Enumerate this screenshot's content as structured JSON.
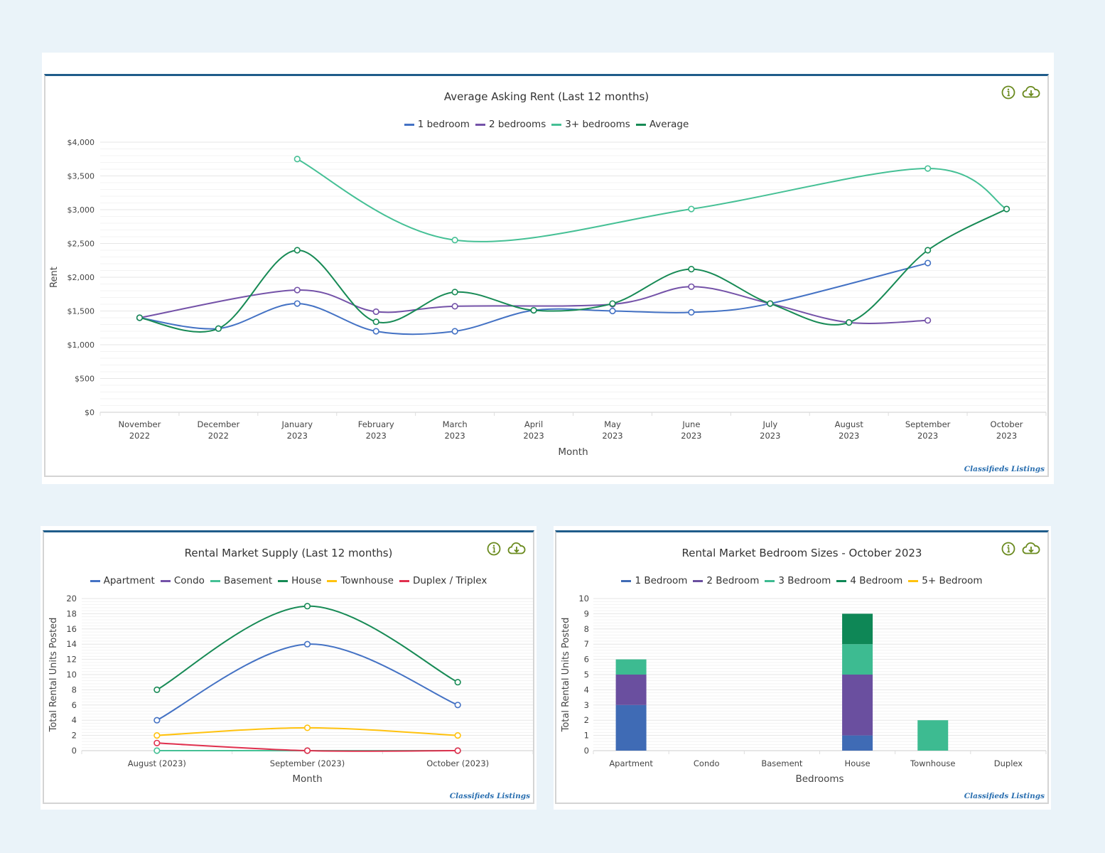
{
  "colors": {
    "panel_top": "#1f5c8a",
    "icon": "#6a8a1e",
    "credit": "#2a6fb0"
  },
  "icons": [
    "info-icon",
    "cloud-download-icon"
  ],
  "credit": "Classifieds Listings",
  "chart_data": [
    {
      "type": "line",
      "title": "Average Asking Rent (Last 12 months)",
      "xlabel": "Month",
      "ylabel": "Rent",
      "ylim": [
        0,
        4000
      ],
      "grid": true,
      "legend": "top",
      "y_ticks": [
        0,
        500,
        1000,
        1500,
        2000,
        2500,
        3000,
        3500,
        4000
      ],
      "y_tick_labels": [
        "$0",
        "$500",
        "$1,000",
        "$1,500",
        "$2,000",
        "$2,500",
        "$3,000",
        "$3,500",
        "$4,000"
      ],
      "categories": [
        [
          "November",
          "2022"
        ],
        [
          "December",
          "2022"
        ],
        [
          "January",
          "2023"
        ],
        [
          "February",
          "2023"
        ],
        [
          "March",
          "2023"
        ],
        [
          "April",
          "2023"
        ],
        [
          "May",
          "2023"
        ],
        [
          "June",
          "2023"
        ],
        [
          "July",
          "2023"
        ],
        [
          "August",
          "2023"
        ],
        [
          "September",
          "2023"
        ],
        [
          "October",
          "2023"
        ]
      ],
      "series": [
        {
          "name": "1 bedroom",
          "color": "#4472c4",
          "values": [
            1400,
            1240,
            1610,
            1200,
            1200,
            1510,
            1500,
            1480,
            1610,
            null,
            2210,
            null
          ]
        },
        {
          "name": "2 bedrooms",
          "color": "#7452a8",
          "values": [
            1400,
            null,
            1810,
            1490,
            1570,
            null,
            1600,
            1860,
            1610,
            1330,
            1360,
            null
          ]
        },
        {
          "name": "3+ bedrooms",
          "color": "#45c095",
          "values": [
            null,
            null,
            3750,
            null,
            2550,
            null,
            null,
            3010,
            null,
            null,
            3610,
            3010
          ]
        },
        {
          "name": "Average",
          "color": "#178a55",
          "values": [
            1400,
            1240,
            2400,
            1340,
            1780,
            1510,
            1610,
            2120,
            1610,
            1330,
            2400,
            3010
          ]
        }
      ]
    },
    {
      "type": "line",
      "title": "Rental Market Supply (Last 12 months)",
      "xlabel": "Month",
      "ylabel": "Total Rental Units Posted",
      "ylim": [
        0,
        20
      ],
      "grid": true,
      "legend": "top",
      "y_ticks": [
        0,
        2,
        4,
        6,
        8,
        10,
        12,
        14,
        16,
        18,
        20
      ],
      "y_tick_labels": [
        "0",
        "2",
        "4",
        "6",
        "8",
        "10",
        "12",
        "14",
        "16",
        "18",
        "20"
      ],
      "categories": [
        "August (2023)",
        "September (2023)",
        "October (2023)"
      ],
      "series": [
        {
          "name": "Apartment",
          "color": "#4472c4",
          "values": [
            4,
            14,
            6
          ]
        },
        {
          "name": "Condo",
          "color": "#7452a8",
          "values": [
            null,
            null,
            null
          ]
        },
        {
          "name": "Basement",
          "color": "#45c095",
          "values": [
            0,
            0,
            0
          ]
        },
        {
          "name": "House",
          "color": "#178a55",
          "values": [
            8,
            19,
            9
          ]
        },
        {
          "name": "Townhouse",
          "color": "#ffc20e",
          "values": [
            2,
            3,
            2
          ]
        },
        {
          "name": "Duplex / Triplex",
          "color": "#e0304e",
          "values": [
            1,
            0,
            0
          ]
        }
      ]
    },
    {
      "type": "bar",
      "stacked": true,
      "title": "Rental Market Bedroom Sizes - October 2023",
      "xlabel": "Bedrooms",
      "ylabel": "Total Rental Units Posted",
      "ylim": [
        0,
        10
      ],
      "grid": true,
      "legend": "top",
      "y_ticks": [
        0,
        1,
        2,
        3,
        4,
        5,
        6,
        7,
        8,
        9,
        10
      ],
      "y_tick_labels": [
        "0",
        "1",
        "2",
        "3",
        "4",
        "5",
        "6",
        "7",
        "8",
        "9",
        "10"
      ],
      "categories": [
        "Apartment",
        "Condo",
        "Basement",
        "House",
        "Townhouse",
        "Duplex"
      ],
      "series": [
        {
          "name": "1 Bedroom",
          "color": "#3f6bb5",
          "values": [
            3,
            0,
            0,
            1,
            0,
            0
          ]
        },
        {
          "name": "2 Bedroom",
          "color": "#6a4f9f",
          "values": [
            2,
            0,
            0,
            4,
            0,
            0
          ]
        },
        {
          "name": "3 Bedroom",
          "color": "#3dbb91",
          "values": [
            1,
            0,
            0,
            2,
            2,
            0
          ]
        },
        {
          "name": "4 Bedroom",
          "color": "#0e8756",
          "values": [
            0,
            0,
            0,
            2,
            0,
            0
          ]
        },
        {
          "name": "5+ Bedroom",
          "color": "#ffc20e",
          "values": [
            0,
            0,
            0,
            0,
            0,
            0
          ]
        }
      ]
    }
  ]
}
